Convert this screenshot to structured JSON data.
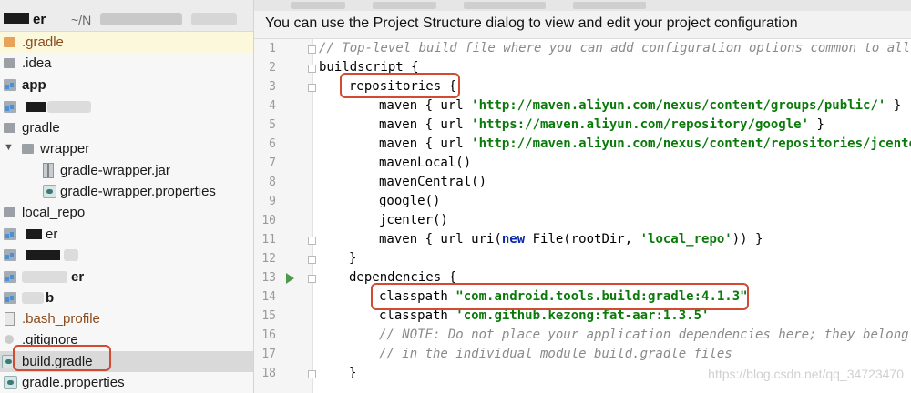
{
  "tree": {
    "project_name": "er",
    "project_path": "~/N",
    "items": [
      {
        "label": ".gradle"
      },
      {
        "label": ".idea"
      },
      {
        "label": "app"
      },
      {
        "label": "gradle"
      },
      {
        "label": "wrapper"
      },
      {
        "label": "gradle-wrapper.jar"
      },
      {
        "label": "gradle-wrapper.properties"
      },
      {
        "label": "local_repo"
      },
      {
        "label": "er"
      },
      {
        "label": "er"
      },
      {
        "label": "b"
      },
      {
        "label": ".bash_profile"
      },
      {
        "label": ".gitignore"
      },
      {
        "label": "build.gradle"
      },
      {
        "label": "gradle.properties"
      }
    ]
  },
  "editor": {
    "banner": "You can use the Project Structure dialog to view and edit your project configuration",
    "line_numbers": [
      "1",
      "2",
      "3",
      "4",
      "5",
      "6",
      "7",
      "8",
      "9",
      "10",
      "11",
      "12",
      "13",
      "14",
      "15",
      "16",
      "17",
      "18"
    ],
    "lines": {
      "l1": "// Top-level build file where you can add configuration options common to all su",
      "l2": "buildscript {",
      "l3": "repositories {",
      "l4a": "maven { url ",
      "l4s": "'http://maven.aliyun.com/nexus/content/groups/public/'",
      "l4b": " }",
      "l5a": "maven { url ",
      "l5s": "'https://maven.aliyun.com/repository/google'",
      "l5b": " }",
      "l6a": "maven { url ",
      "l6s": "'http://maven.aliyun.com/nexus/content/repositories/jcenter'",
      "l7": "mavenLocal()",
      "l8": "mavenCentral()",
      "l9": "google()",
      "l10": "jcenter()",
      "l11a": "maven { url uri(",
      "l11k": "new",
      "l11b": " File(rootDir, ",
      "l11s": "'local_repo'",
      "l11c": ")) }",
      "l12": "}",
      "l13": "dependencies {",
      "l14a": "classpath ",
      "l14s": "\"com.android.tools.build:gradle:4.1.3\"",
      "l15a": "classpath ",
      "l15s": "'com.github.kezong:fat-aar:1.3.5'",
      "l16": "// NOTE: Do not place your application dependencies here; they belong",
      "l17": "// in the individual module build.gradle files",
      "l18": "}"
    }
  },
  "watermark": "https://blog.csdn.net/qq_34723470",
  "colors": {
    "string": "#0a7a0a",
    "keyword": "#0a2aa6",
    "comment": "#8a8a8a",
    "annotation_box": "#d14b33"
  }
}
